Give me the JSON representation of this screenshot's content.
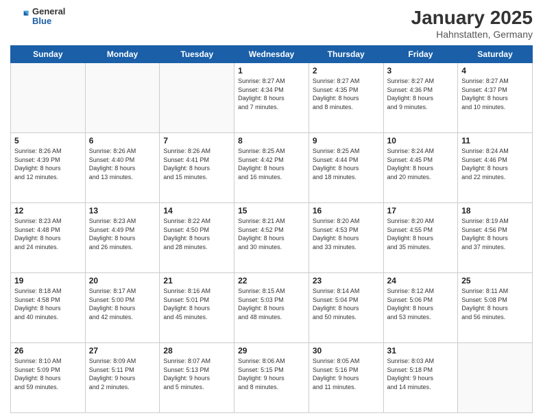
{
  "header": {
    "logo": {
      "general": "General",
      "blue": "Blue"
    },
    "title": "January 2025",
    "location": "Hahnstatten, Germany"
  },
  "weekdays": [
    "Sunday",
    "Monday",
    "Tuesday",
    "Wednesday",
    "Thursday",
    "Friday",
    "Saturday"
  ],
  "weeks": [
    [
      {
        "day": "",
        "info": ""
      },
      {
        "day": "",
        "info": ""
      },
      {
        "day": "",
        "info": ""
      },
      {
        "day": "1",
        "info": "Sunrise: 8:27 AM\nSunset: 4:34 PM\nDaylight: 8 hours\nand 7 minutes."
      },
      {
        "day": "2",
        "info": "Sunrise: 8:27 AM\nSunset: 4:35 PM\nDaylight: 8 hours\nand 8 minutes."
      },
      {
        "day": "3",
        "info": "Sunrise: 8:27 AM\nSunset: 4:36 PM\nDaylight: 8 hours\nand 9 minutes."
      },
      {
        "day": "4",
        "info": "Sunrise: 8:27 AM\nSunset: 4:37 PM\nDaylight: 8 hours\nand 10 minutes."
      }
    ],
    [
      {
        "day": "5",
        "info": "Sunrise: 8:26 AM\nSunset: 4:39 PM\nDaylight: 8 hours\nand 12 minutes."
      },
      {
        "day": "6",
        "info": "Sunrise: 8:26 AM\nSunset: 4:40 PM\nDaylight: 8 hours\nand 13 minutes."
      },
      {
        "day": "7",
        "info": "Sunrise: 8:26 AM\nSunset: 4:41 PM\nDaylight: 8 hours\nand 15 minutes."
      },
      {
        "day": "8",
        "info": "Sunrise: 8:25 AM\nSunset: 4:42 PM\nDaylight: 8 hours\nand 16 minutes."
      },
      {
        "day": "9",
        "info": "Sunrise: 8:25 AM\nSunset: 4:44 PM\nDaylight: 8 hours\nand 18 minutes."
      },
      {
        "day": "10",
        "info": "Sunrise: 8:24 AM\nSunset: 4:45 PM\nDaylight: 8 hours\nand 20 minutes."
      },
      {
        "day": "11",
        "info": "Sunrise: 8:24 AM\nSunset: 4:46 PM\nDaylight: 8 hours\nand 22 minutes."
      }
    ],
    [
      {
        "day": "12",
        "info": "Sunrise: 8:23 AM\nSunset: 4:48 PM\nDaylight: 8 hours\nand 24 minutes."
      },
      {
        "day": "13",
        "info": "Sunrise: 8:23 AM\nSunset: 4:49 PM\nDaylight: 8 hours\nand 26 minutes."
      },
      {
        "day": "14",
        "info": "Sunrise: 8:22 AM\nSunset: 4:50 PM\nDaylight: 8 hours\nand 28 minutes."
      },
      {
        "day": "15",
        "info": "Sunrise: 8:21 AM\nSunset: 4:52 PM\nDaylight: 8 hours\nand 30 minutes."
      },
      {
        "day": "16",
        "info": "Sunrise: 8:20 AM\nSunset: 4:53 PM\nDaylight: 8 hours\nand 33 minutes."
      },
      {
        "day": "17",
        "info": "Sunrise: 8:20 AM\nSunset: 4:55 PM\nDaylight: 8 hours\nand 35 minutes."
      },
      {
        "day": "18",
        "info": "Sunrise: 8:19 AM\nSunset: 4:56 PM\nDaylight: 8 hours\nand 37 minutes."
      }
    ],
    [
      {
        "day": "19",
        "info": "Sunrise: 8:18 AM\nSunset: 4:58 PM\nDaylight: 8 hours\nand 40 minutes."
      },
      {
        "day": "20",
        "info": "Sunrise: 8:17 AM\nSunset: 5:00 PM\nDaylight: 8 hours\nand 42 minutes."
      },
      {
        "day": "21",
        "info": "Sunrise: 8:16 AM\nSunset: 5:01 PM\nDaylight: 8 hours\nand 45 minutes."
      },
      {
        "day": "22",
        "info": "Sunrise: 8:15 AM\nSunset: 5:03 PM\nDaylight: 8 hours\nand 48 minutes."
      },
      {
        "day": "23",
        "info": "Sunrise: 8:14 AM\nSunset: 5:04 PM\nDaylight: 8 hours\nand 50 minutes."
      },
      {
        "day": "24",
        "info": "Sunrise: 8:12 AM\nSunset: 5:06 PM\nDaylight: 8 hours\nand 53 minutes."
      },
      {
        "day": "25",
        "info": "Sunrise: 8:11 AM\nSunset: 5:08 PM\nDaylight: 8 hours\nand 56 minutes."
      }
    ],
    [
      {
        "day": "26",
        "info": "Sunrise: 8:10 AM\nSunset: 5:09 PM\nDaylight: 8 hours\nand 59 minutes."
      },
      {
        "day": "27",
        "info": "Sunrise: 8:09 AM\nSunset: 5:11 PM\nDaylight: 9 hours\nand 2 minutes."
      },
      {
        "day": "28",
        "info": "Sunrise: 8:07 AM\nSunset: 5:13 PM\nDaylight: 9 hours\nand 5 minutes."
      },
      {
        "day": "29",
        "info": "Sunrise: 8:06 AM\nSunset: 5:15 PM\nDaylight: 9 hours\nand 8 minutes."
      },
      {
        "day": "30",
        "info": "Sunrise: 8:05 AM\nSunset: 5:16 PM\nDaylight: 9 hours\nand 11 minutes."
      },
      {
        "day": "31",
        "info": "Sunrise: 8:03 AM\nSunset: 5:18 PM\nDaylight: 9 hours\nand 14 minutes."
      },
      {
        "day": "",
        "info": ""
      }
    ]
  ]
}
